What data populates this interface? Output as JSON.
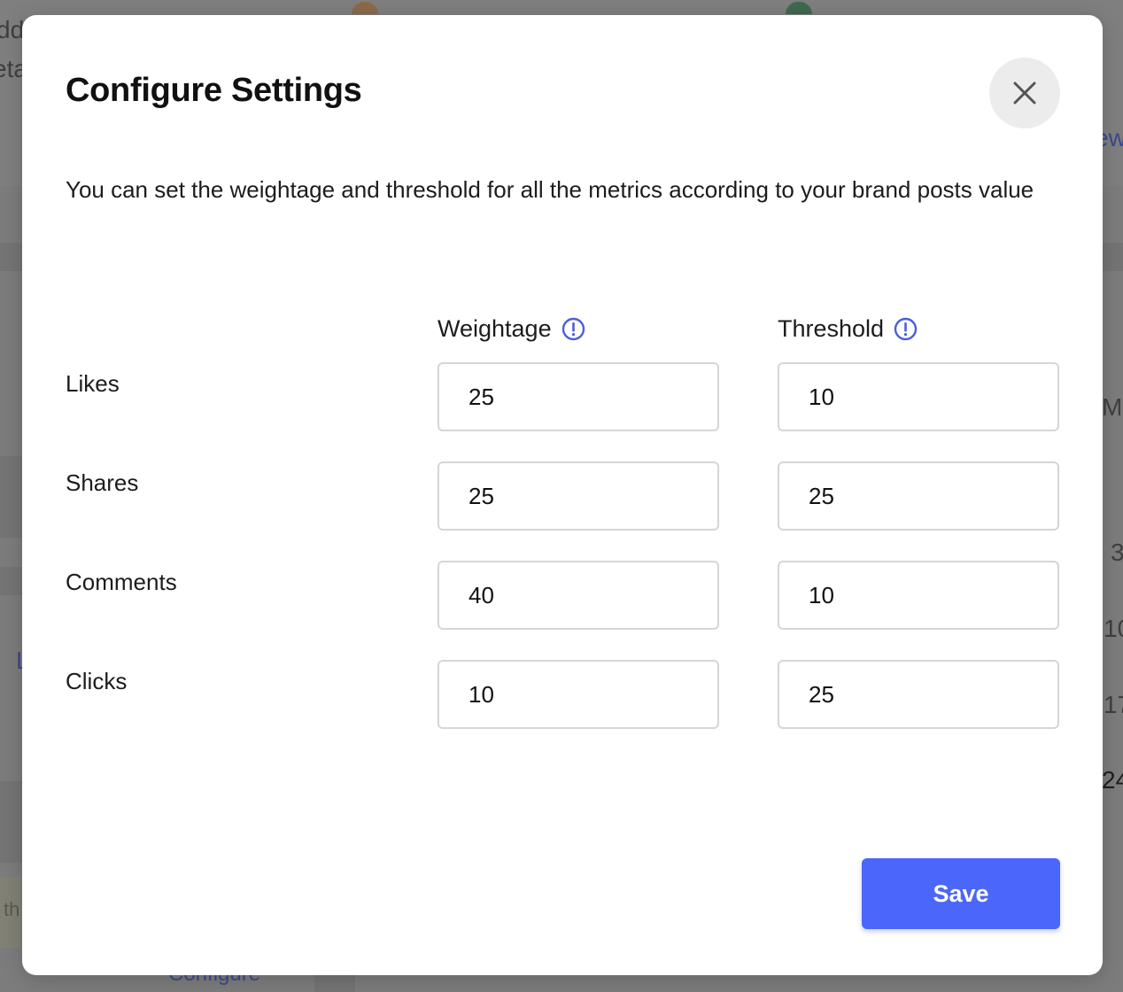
{
  "background": {
    "fragments": [
      {
        "id": "bg-frag-1",
        "text": "dd"
      },
      {
        "id": "bg-frag-2",
        "text": "eta"
      },
      {
        "id": "bg-frag-3",
        "text": "ew"
      },
      {
        "id": "bg-frag-4",
        "text": "Mo"
      },
      {
        "id": "bg-frag-5",
        "text": "3"
      },
      {
        "id": "bg-frag-6",
        "text": "10"
      },
      {
        "id": "bg-frag-7",
        "text": "17"
      },
      {
        "id": "bg-frag-8",
        "text": "24"
      },
      {
        "id": "bg-frag-9",
        "text": "th"
      },
      {
        "id": "bg-frag-10",
        "text": "Configure"
      },
      {
        "id": "bg-frag-11",
        "text": "L"
      }
    ]
  },
  "modal": {
    "title": "Configure Settings",
    "close_icon": "close-icon",
    "description": "You can set the weightage and threshold for all the metrics according to your brand posts value",
    "columns": {
      "weightage": "Weightage",
      "threshold": "Threshold"
    },
    "info_icon": "info-icon",
    "metrics": [
      {
        "label": "Likes",
        "weightage": "25",
        "threshold": "10"
      },
      {
        "label": "Shares",
        "weightage": "25",
        "threshold": "25"
      },
      {
        "label": "Comments",
        "weightage": "40",
        "threshold": "10"
      },
      {
        "label": "Clicks",
        "weightage": "10",
        "threshold": "25"
      }
    ],
    "save_label": "Save"
  },
  "colors": {
    "accent": "#4b66fb",
    "info_icon": "#4b5fd9",
    "overlay": "#7c7c7c",
    "input_border": "#d6d6d9"
  }
}
